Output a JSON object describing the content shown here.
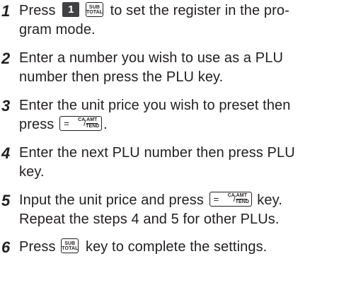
{
  "steps": [
    {
      "number": "1",
      "before": "Press",
      "key_one": "1",
      "after": "to set the register in the pro-",
      "line2": "gram mode."
    },
    {
      "number": "2",
      "line1": "Enter a number you wish to use as a PLU",
      "line2": "number then press the PLU key."
    },
    {
      "number": "3",
      "line1": "Enter the unit price you wish to preset then",
      "before2": "press",
      "after2": "."
    },
    {
      "number": "4",
      "line1": "Enter the next PLU number then press PLU",
      "line2": "key."
    },
    {
      "number": "5",
      "before": "Input the unit price and press",
      "after": "key.",
      "line2": "Repeat the steps 4 and 5 for other PLUs."
    },
    {
      "number": "6",
      "before": "Press",
      "after": "key to complete the settings."
    }
  ],
  "keys": {
    "subtotal_top": "SUB",
    "subtotal_bottom": "TOTAL",
    "ca_eq": "=",
    "ca_left": "CA",
    "ca_slash": "/",
    "ca_amt": "AMT",
    "ca_tend": "TEND"
  }
}
